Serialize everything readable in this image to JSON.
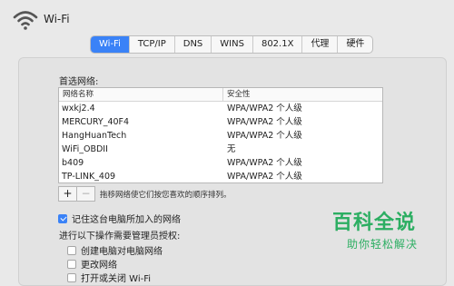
{
  "header": {
    "title": "Wi-Fi"
  },
  "tabs": [
    {
      "label": "Wi-Fi",
      "active": true
    },
    {
      "label": "TCP/IP",
      "active": false
    },
    {
      "label": "DNS",
      "active": false
    },
    {
      "label": "WINS",
      "active": false
    },
    {
      "label": "802.1X",
      "active": false
    },
    {
      "label": "代理",
      "active": false
    },
    {
      "label": "硬件",
      "active": false
    }
  ],
  "preferred": {
    "label": "首选网络:",
    "columns": {
      "name": "网络名称",
      "security": "安全性"
    },
    "rows": [
      {
        "name": "wxkj2.4",
        "security": "WPA/WPA2 个人级"
      },
      {
        "name": "MERCURY_40F4",
        "security": "WPA/WPA2 个人级"
      },
      {
        "name": "HangHuanTech",
        "security": "WPA/WPA2 个人级"
      },
      {
        "name": "WiFi_OBDII",
        "security": "无"
      },
      {
        "name": "b409",
        "security": "WPA/WPA2 个人级"
      },
      {
        "name": "TP-LINK_409",
        "security": "WPA/WPA2 个人级"
      }
    ],
    "add_label": "+",
    "remove_label": "−",
    "drag_hint": "拖移网络使它们按您喜欢的顺序排列。"
  },
  "remember": {
    "label": "记住这台电脑所加入的网络",
    "checked": true
  },
  "admin": {
    "label": "进行以下操作需要管理员授权:",
    "options": [
      {
        "label": "创建电脑对电脑网络",
        "checked": false
      },
      {
        "label": "更改网络",
        "checked": false
      },
      {
        "label": "打开或关闭 Wi-Fi",
        "checked": false
      }
    ]
  },
  "watermark": {
    "title": "百科全说",
    "subtitle": "助你轻松解决"
  },
  "colors": {
    "accent": "#3a82f7",
    "watermark": "#2cae62"
  }
}
